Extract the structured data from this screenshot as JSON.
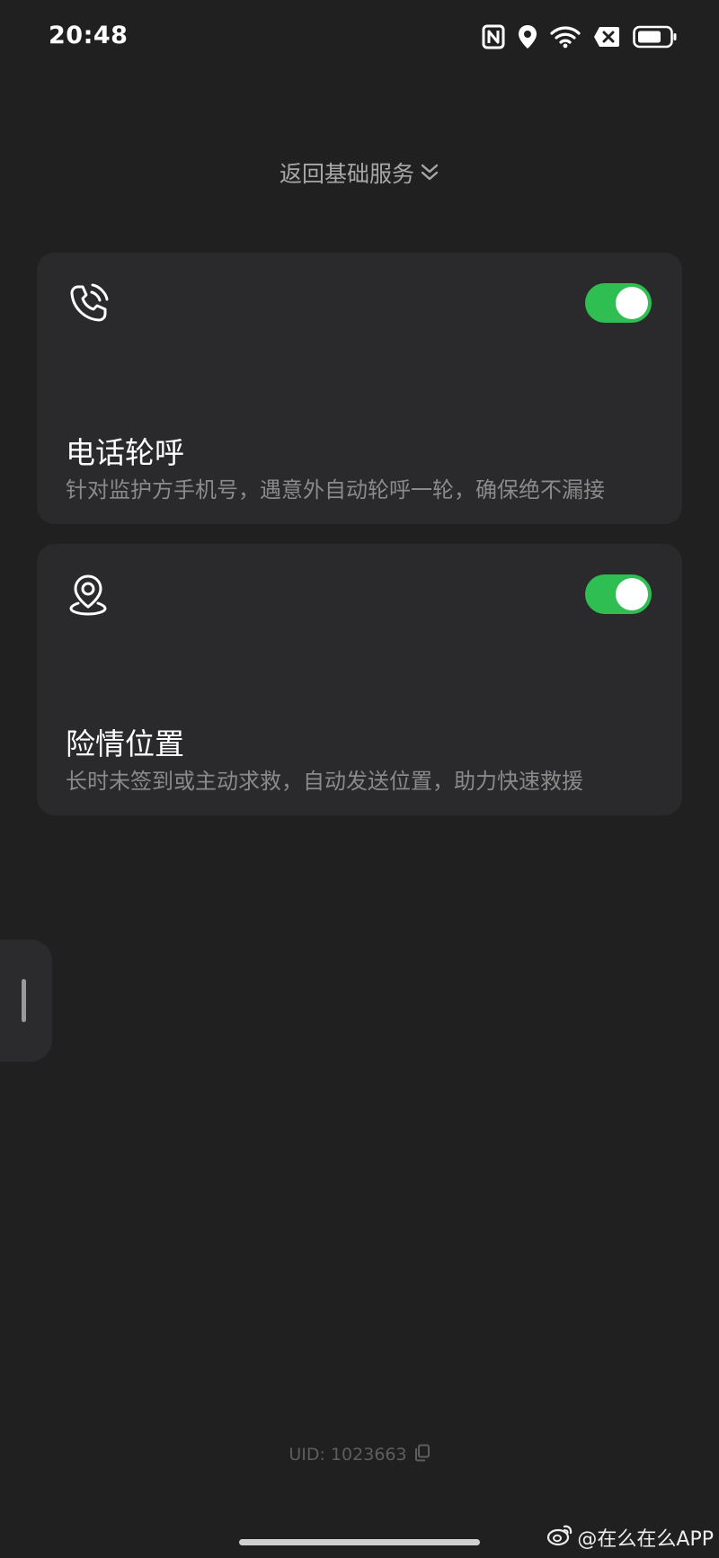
{
  "status_bar": {
    "time": "20:48",
    "icons": [
      "nfc-icon",
      "location-icon",
      "wifi-icon",
      "sim-no-signal-icon",
      "battery-icon"
    ],
    "battery_level": 0.6
  },
  "header": {
    "back_label": "返回基础服务",
    "back_icon": "double-chevron-down-icon"
  },
  "cards": [
    {
      "icon": "phone-call-icon",
      "title": "电话轮呼",
      "description": "针对监护方手机号，遇意外自动轮呼一轮，确保绝不漏接",
      "enabled": true
    },
    {
      "icon": "location-pin-icon",
      "title": "险情位置",
      "description": "长时未签到或主动求救，自动发送位置，助力快速救援",
      "enabled": true
    }
  ],
  "footer": {
    "uid": "UID: 1023663",
    "copy_icon": "copy-icon"
  },
  "watermark": {
    "text": "@在么在么APP",
    "icon": "weibo-icon"
  },
  "colors": {
    "background": "#202020",
    "card": "#2a2a2c",
    "toggle_on": "#2fbe52",
    "secondary_text": "#8a8a8a"
  }
}
